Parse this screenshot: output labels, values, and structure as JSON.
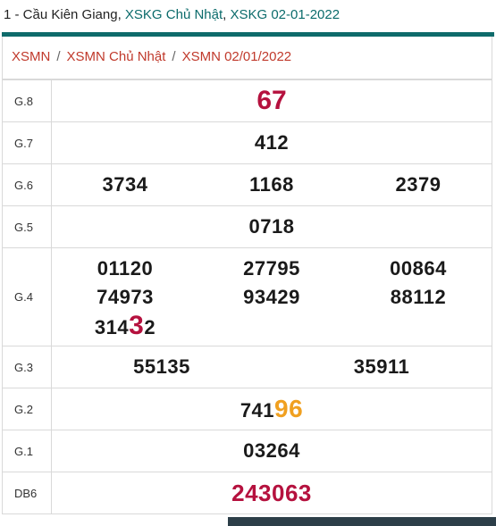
{
  "page_title": {
    "prefix": "1 - Cầu Kiên Giang, ",
    "part2": "XSKG Chủ Nhật",
    "sep": ", ",
    "part3": "XSKG 02-01-2022"
  },
  "breadcrumb": {
    "items": [
      "XSMN",
      "XSMN Chủ Nhật",
      "XSMN 02/01/2022"
    ],
    "separator": "/"
  },
  "results": {
    "g8": {
      "label": "G.8",
      "value": "67"
    },
    "g7": {
      "label": "G.7",
      "value": "412"
    },
    "g6": {
      "label": "G.6",
      "values": [
        "3734",
        "1168",
        "2379"
      ]
    },
    "g5": {
      "label": "G.5",
      "value": "0718"
    },
    "g4": {
      "label": "G.4",
      "values": [
        "01120",
        "27795",
        "00864",
        "74973",
        "93429",
        "88112"
      ],
      "last_prefix": "314",
      "last_highlight": "3",
      "last_suffix": "2"
    },
    "g3": {
      "label": "G.3",
      "values": [
        "55135",
        "35911"
      ]
    },
    "g2": {
      "label": "G.2",
      "prefix": "741",
      "highlight": "96"
    },
    "g1": {
      "label": "G.1",
      "value": "03264"
    },
    "db": {
      "label": "DB6",
      "value": "243063"
    }
  },
  "colors": {
    "accent_teal": "#0e6b6b",
    "highlight_red": "#b5113e",
    "highlight_orange": "#f0a020",
    "link_red": "#c0392b"
  }
}
